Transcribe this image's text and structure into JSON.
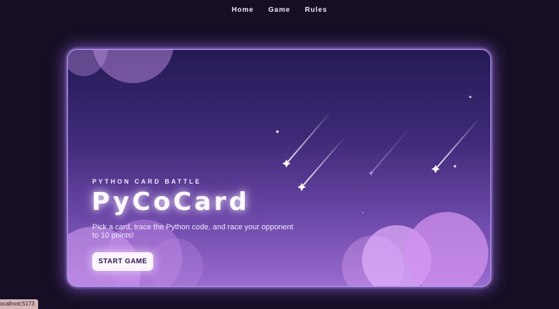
{
  "nav": {
    "items": [
      {
        "label": "Home"
      },
      {
        "label": "Game"
      },
      {
        "label": "Rules"
      }
    ]
  },
  "hero": {
    "eyebrow": "PYTHON CARD BATTLE",
    "title": "PyCoCard",
    "subtitle": "Pick a card, trace the Python code, and race your opponent to 10 points!",
    "cta_label": "START GAME"
  },
  "status_bar": {
    "url": "ocalhost:5173"
  },
  "colors": {
    "background": "#160e25",
    "card_top": "#241a55",
    "card_bottom": "#9a6ccf",
    "card_border": "#b99bff",
    "button_bg": "#fbf4ff",
    "button_text": "#2a1850"
  },
  "decorations": {
    "shooting_stars": 5,
    "icons": [
      "shooting-star-icon",
      "sparkle-icon"
    ]
  }
}
